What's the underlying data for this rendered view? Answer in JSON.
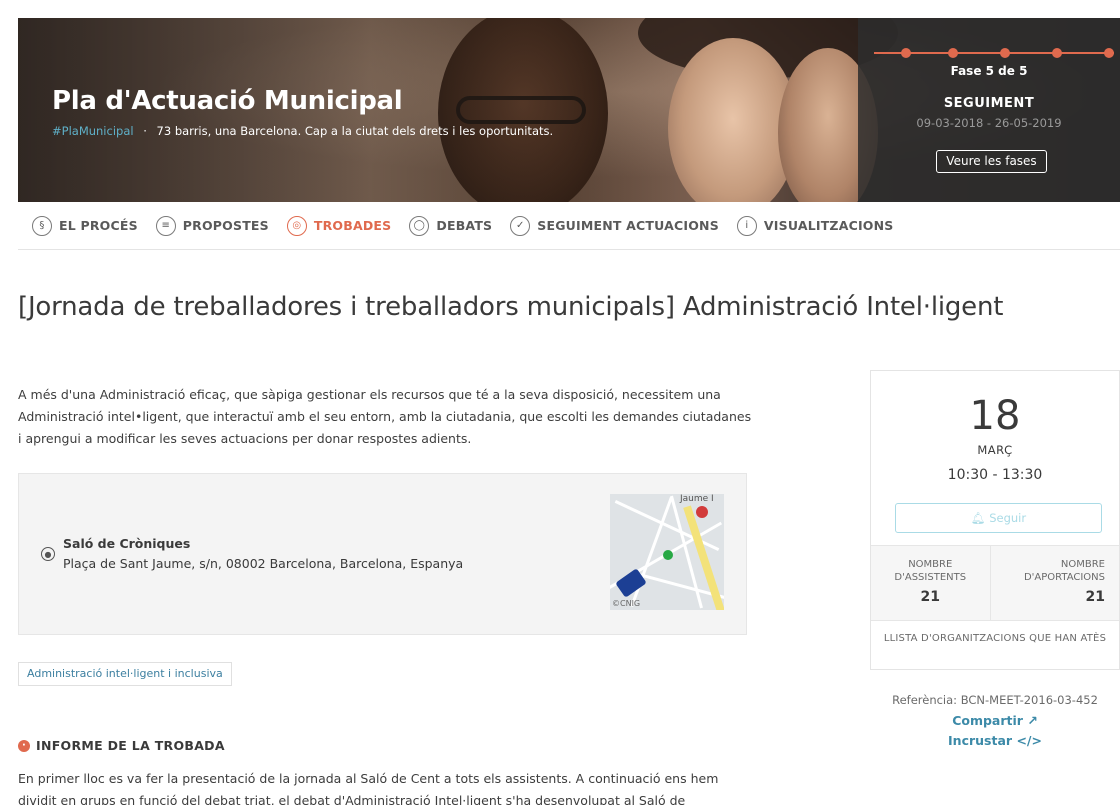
{
  "hero": {
    "title": "Pla d'Actuació Municipal",
    "hashtag": "#PlaMunicipal",
    "separator": "·",
    "subtitle": "73 barris, una Barcelona. Cap a la ciutat dels drets i les oportunitats."
  },
  "phase": {
    "label": "Fase 5 de 5",
    "name": "SEGUIMENT",
    "dates": "09-03-2018 - 26-05-2019",
    "button": "Veure les fases",
    "current": 5,
    "total": 5
  },
  "nav": {
    "items": [
      {
        "label": "EL PROCÉS",
        "icon": "process-icon",
        "glyph": "§"
      },
      {
        "label": "PROPOSTES",
        "icon": "proposals-icon",
        "glyph": "≡"
      },
      {
        "label": "TROBADES",
        "icon": "meetings-icon",
        "glyph": "◎",
        "active": true
      },
      {
        "label": "DEBATS",
        "icon": "debates-icon",
        "glyph": "◯"
      },
      {
        "label": "SEGUIMENT ACTUACIONS",
        "icon": "check-icon",
        "glyph": "✓"
      },
      {
        "label": "VISUALITZACIONS",
        "icon": "info-icon",
        "glyph": "i"
      }
    ]
  },
  "title": "[Jornada de treballadores i treballadors municipals] Administració Intel·ligent",
  "description": "A més d'una Administració eficaç, que sàpiga gestionar els recursos que té a la seva disposició, necessitem una Administració intel•ligent, que interactuï amb el seu entorn, amb la ciutadania, que escolti les demandes ciutadanes i aprengui a modificar les seves actuacions per donar respostes adients.",
  "address": {
    "name": "Saló de Cròniques",
    "line": "Plaça de Sant Jaume, s/n, 08002 Barcelona, Barcelona, Espanya",
    "map_label": "Jaume I",
    "map_copyright": "©CNIG"
  },
  "tag": "Administració intel·ligent i inclusiva",
  "report": {
    "heading": "INFORME DE LA TROBADA",
    "text": "En primer lloc es va fer la presentació de la jornada al Saló de Cent a tots els assistents. A continuació ens hem dividit en grups en funció del debat triat, el debat d'Administració Intel·ligent s'ha desenvolupat al Saló de"
  },
  "card": {
    "day": "18",
    "month": "MARÇ",
    "time": "10:30 - 13:30",
    "follow": "Seguir",
    "attendees_label": "NOMBRE D'ASSISTENTS",
    "attendees_value": "21",
    "contributions_label": "NOMBRE D'APORTACIONS",
    "contributions_value": "21",
    "orgs": "LLISTA D'ORGANITZACIONS QUE HAN ATÈS"
  },
  "reference": "Referència: BCN-MEET-2016-03-452",
  "share": "Compartir",
  "embed": "Incrustar",
  "colors": {
    "accent": "#e06a4e",
    "link": "#3c8aa8",
    "hashtag": "#5fb0c8"
  }
}
